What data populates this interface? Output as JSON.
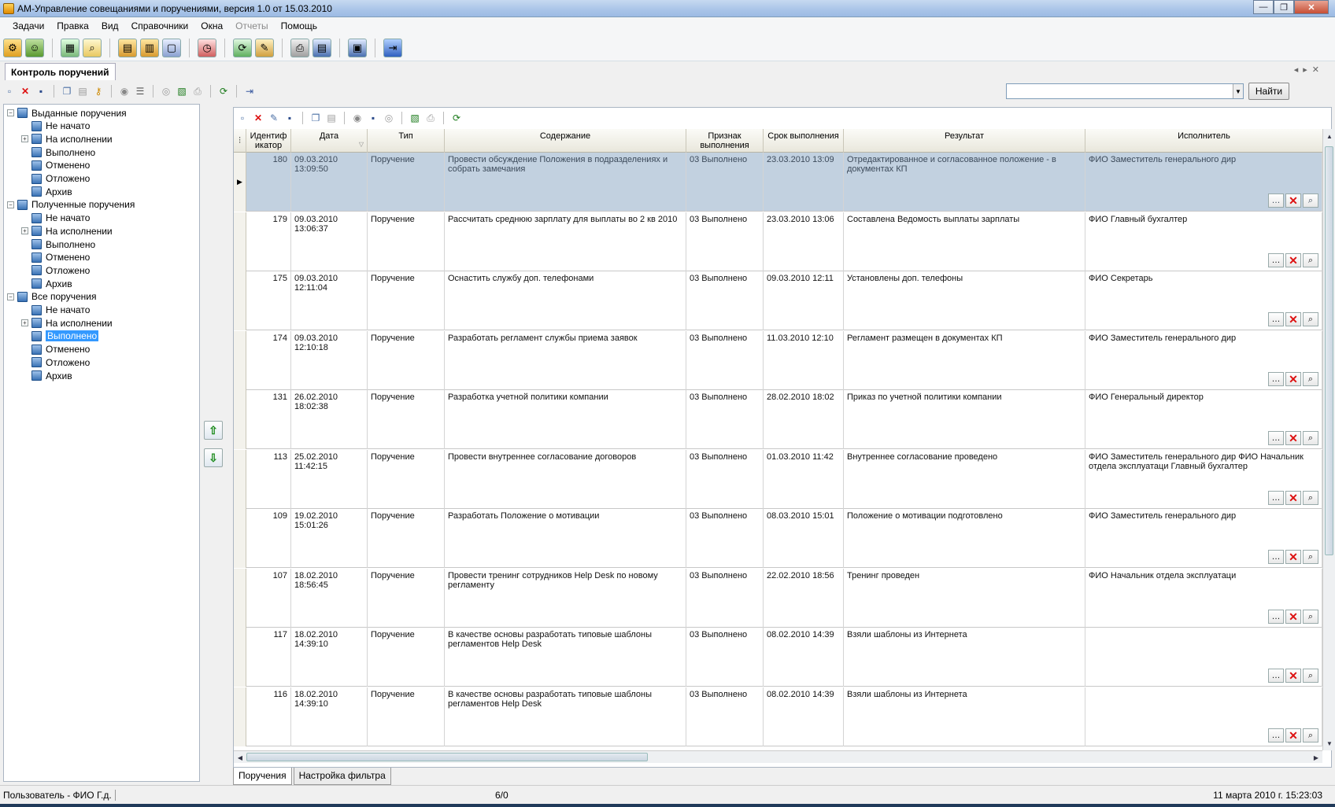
{
  "window": {
    "title": "АМ-Управление совещаниями и поручениями, версия 1.0 от 15.03.2010",
    "min": "—",
    "max": "❐",
    "close": "✕"
  },
  "menu": [
    "Задачи",
    "Правка",
    "Вид",
    "Справочники",
    "Окна",
    "Отчеты",
    "Помощь"
  ],
  "doc_tab": "Контроль поручений",
  "search": {
    "placeholder": "",
    "button": "Найти"
  },
  "tree": [
    {
      "label": "Выданные поручения",
      "level": 0,
      "expander": "−"
    },
    {
      "label": "Не начато",
      "level": 1
    },
    {
      "label": "На исполнении",
      "level": 1,
      "expander": "+"
    },
    {
      "label": "Выполнено",
      "level": 1
    },
    {
      "label": "Отменено",
      "level": 1
    },
    {
      "label": "Отложено",
      "level": 1
    },
    {
      "label": "Архив",
      "level": 1
    },
    {
      "label": "Полученные поручения",
      "level": 0,
      "expander": "−"
    },
    {
      "label": "Не начато",
      "level": 1
    },
    {
      "label": "На исполнении",
      "level": 1,
      "expander": "+"
    },
    {
      "label": "Выполнено",
      "level": 1
    },
    {
      "label": "Отменено",
      "level": 1
    },
    {
      "label": "Отложено",
      "level": 1
    },
    {
      "label": "Архив",
      "level": 1
    },
    {
      "label": "Все поручения",
      "level": 0,
      "expander": "−"
    },
    {
      "label": "Не начато",
      "level": 1
    },
    {
      "label": "На исполнении",
      "level": 1,
      "expander": "+"
    },
    {
      "label": "Выполнено",
      "level": 1,
      "selected": true
    },
    {
      "label": "Отменено",
      "level": 1
    },
    {
      "label": "Отложено",
      "level": 1
    },
    {
      "label": "Архив",
      "level": 1
    }
  ],
  "grid": {
    "columns": [
      "Идентиф икатор",
      "Дата",
      "Тип",
      "Содержание",
      "Признак выполнения",
      "Срок выполнения",
      "Результат",
      "Исполнитель"
    ],
    "rows": [
      {
        "id": "180",
        "date": "09.03.2010 13:09:50",
        "type": "Поручение",
        "content": "Провести обсуждение Положения в подразделениях и собрать замечания",
        "status": "03 Выполнено",
        "deadline": "23.03.2010 13:09",
        "result": "Отредактированное и согласованное положение - в документах КП",
        "executor": "ФИО Заместитель генерального дир"
      },
      {
        "id": "179",
        "date": "09.03.2010 13:06:37",
        "type": "Поручение",
        "content": "Рассчитать среднюю зарплату для выплаты во 2 кв 2010",
        "status": "03 Выполнено",
        "deadline": "23.03.2010 13:06",
        "result": "Составлена Ведомость выплаты зарплаты",
        "executor": "ФИО Главный бухгалтер"
      },
      {
        "id": "175",
        "date": "09.03.2010 12:11:04",
        "type": "Поручение",
        "content": "Оснастить службу доп. телефонами",
        "status": "03 Выполнено",
        "deadline": "09.03.2010 12:11",
        "result": "Установлены доп. телефоны",
        "executor": "ФИО Секретарь"
      },
      {
        "id": "174",
        "date": "09.03.2010 12:10:18",
        "type": "Поручение",
        "content": "Разработать регламент службы приема заявок",
        "status": "03 Выполнено",
        "deadline": "11.03.2010 12:10",
        "result": "Регламент размещен в документах КП",
        "executor": "ФИО Заместитель генерального дир"
      },
      {
        "id": "131",
        "date": "26.02.2010 18:02:38",
        "type": "Поручение",
        "content": "Разработка учетной политики компании",
        "status": "03 Выполнено",
        "deadline": "28.02.2010 18:02",
        "result": "Приказ по учетной политики компании",
        "executor": "ФИО Генеральный директор"
      },
      {
        "id": "113",
        "date": "25.02.2010 11:42:15",
        "type": "Поручение",
        "content": "Провести внутреннее согласование договоров",
        "status": "03 Выполнено",
        "deadline": "01.03.2010 11:42",
        "result": "Внутреннее согласование проведено",
        "executor": "ФИО Заместитель генерального дир ФИО Начальник отдела эксплуатаци Главный бухгалтер"
      },
      {
        "id": "109",
        "date": "19.02.2010 15:01:26",
        "type": "Поручение",
        "content": "Разработать Положение о мотивации",
        "status": "03 Выполнено",
        "deadline": "08.03.2010 15:01",
        "result": "Положение о мотивации подготовлено",
        "executor": "ФИО Заместитель генерального дир"
      },
      {
        "id": "107",
        "date": "18.02.2010 18:56:45",
        "type": "Поручение",
        "content": "Провести тренинг сотрудников Help Desk по новому регламенту",
        "status": "03 Выполнено",
        "deadline": "22.02.2010 18:56",
        "result": "Тренинг проведен",
        "executor": "ФИО Начальник отдела эксплуатаци"
      },
      {
        "id": "117",
        "date": "18.02.2010 14:39:10",
        "type": "Поручение",
        "content": "В качестве основы разработать типовые шаблоны регламентов Help Desk",
        "status": "03 Выполнено",
        "deadline": "08.02.2010 14:39",
        "result": "Взяли шаблоны из Интернета",
        "executor": ""
      },
      {
        "id": "116",
        "date": "18.02.2010 14:39:10",
        "type": "Поручение",
        "content": "В качестве основы разработать типовые шаблоны регламентов Help Desk",
        "status": "03 Выполнено",
        "deadline": "08.02.2010 14:39",
        "result": "Взяли шаблоны из Интернета",
        "executor": ""
      }
    ]
  },
  "bottom_tabs": [
    "Поручения",
    "Настройка фильтра"
  ],
  "status": {
    "user": "Пользователь - ФИО Г.д.",
    "count": "6/0",
    "datetime": "11 марта 2010 г. 15:23:03"
  }
}
